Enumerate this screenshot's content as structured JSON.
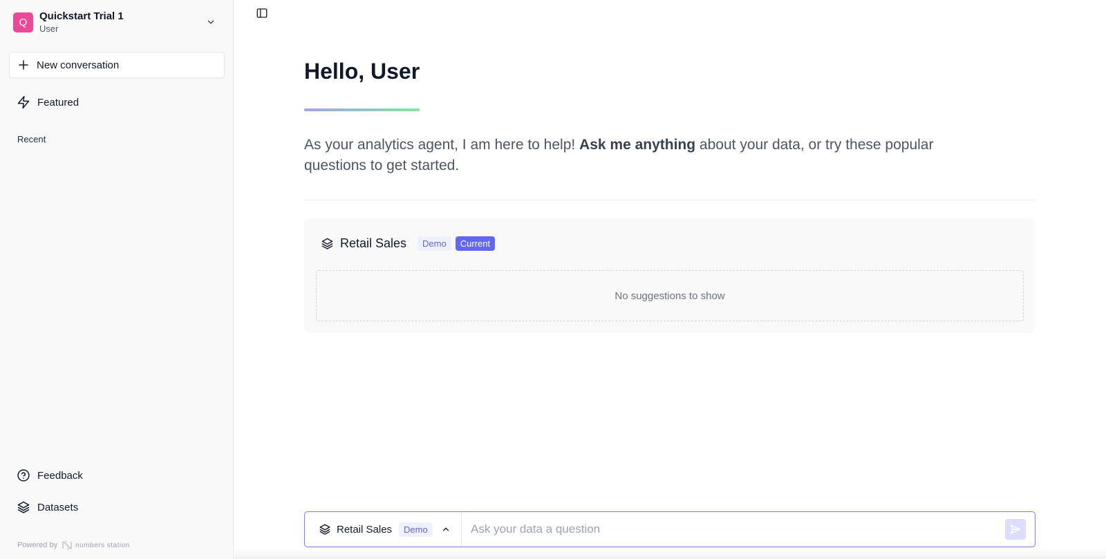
{
  "sidebar": {
    "workspace": {
      "initial": "Q",
      "name": "Quickstart Trial 1",
      "role": "User",
      "avatar_color": "#ec4899"
    },
    "new_conversation_label": "New conversation",
    "featured_label": "Featured",
    "recent_label": "Recent",
    "feedback_label": "Feedback",
    "datasets_label": "Datasets",
    "powered_by": "Powered by",
    "brand": "numbers station"
  },
  "main": {
    "greeting": "Hello, User",
    "intro_before": "As your analytics agent, I am here to help! ",
    "intro_bold": "Ask me anything",
    "intro_after": " about your data, or try these popular questions to get started.",
    "dataset_card": {
      "title": "Retail Sales",
      "badges": [
        "Demo",
        "Current"
      ],
      "empty_message": "No suggestions to show"
    }
  },
  "composer": {
    "dataset_name": "Retail Sales",
    "dataset_badge": "Demo",
    "placeholder": "Ask your data a question",
    "value": ""
  },
  "colors": {
    "accent": "#6366f1",
    "gradient_start": "#a5a0ee",
    "gradient_end": "#86e3a0"
  }
}
